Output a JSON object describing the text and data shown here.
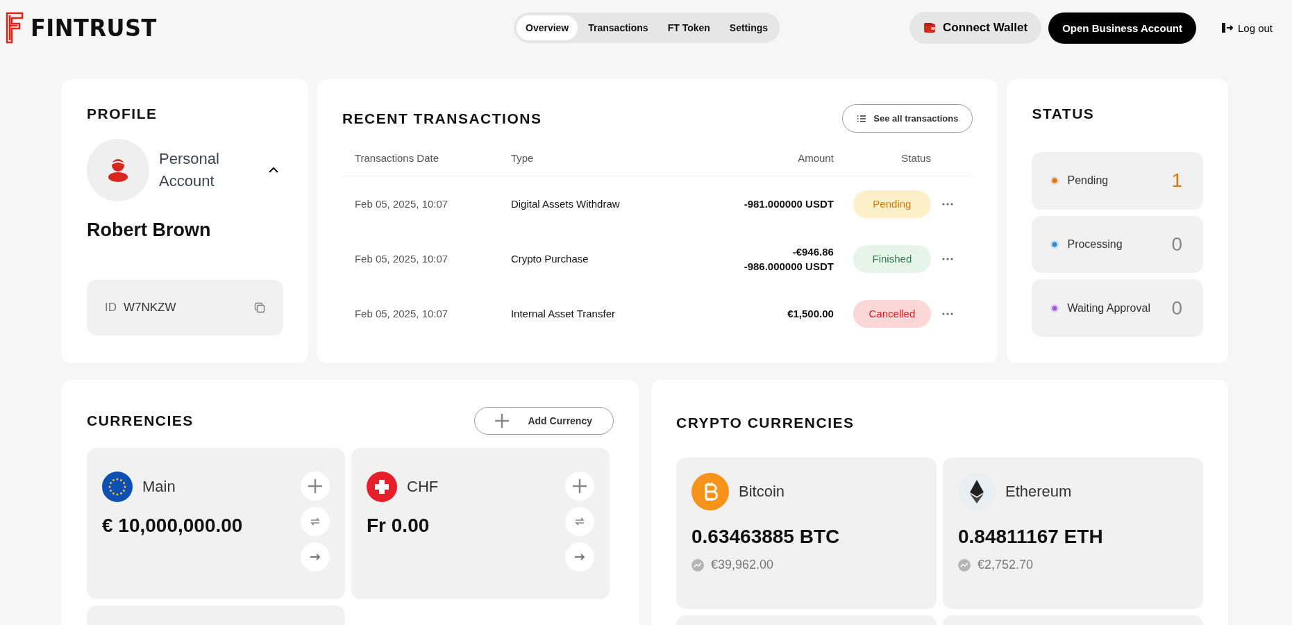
{
  "header": {
    "logo": "FINTRUST",
    "tabs": [
      {
        "label": "Overview",
        "selected": true
      },
      {
        "label": "Transactions",
        "selected": false
      },
      {
        "label": "FT Token",
        "selected": false
      },
      {
        "label": "Settings",
        "selected": false
      }
    ],
    "connect_wallet": "Connect Wallet",
    "open_business": "Open Business Account",
    "logout": "Log out"
  },
  "profile": {
    "title": "PROFILE",
    "account_type": "Personal Account",
    "expanded": true,
    "name": "Robert Brown",
    "id_label": "ID",
    "id_value": "W7NKZW"
  },
  "transactions": {
    "title": "RECENT TRANSACTIONS",
    "see_all": "See all transactions",
    "columns": [
      "Transactions Date",
      "Type",
      "Amount",
      "Status"
    ],
    "rows": [
      {
        "date": "Feb 05, 2025, 10:07",
        "type": "Digital Assets Withdraw",
        "amount": [
          "-981.000000 USDT"
        ],
        "status": "Pending",
        "kind": "pending"
      },
      {
        "date": "Feb 05, 2025, 10:07",
        "type": "Crypto Purchase",
        "amount": [
          "-€946.86",
          "-986.000000 USDT"
        ],
        "status": "Finished",
        "kind": "finished"
      },
      {
        "date": "Feb 05, 2025, 10:07",
        "type": "Internal Asset Transfer",
        "amount": [
          "€1,500.00"
        ],
        "status": "Cancelled",
        "kind": "cancelled"
      }
    ]
  },
  "status": {
    "title": "STATUS",
    "items": [
      {
        "label": "Pending",
        "count": "1",
        "color": "#d97a0a",
        "highlighted": true
      },
      {
        "label": "Processing",
        "count": "0",
        "color": "#2d8fd8",
        "highlighted": false
      },
      {
        "label": "Waiting Approval",
        "count": "0",
        "color": "#a45ae8",
        "highlighted": false
      }
    ]
  },
  "currencies": {
    "title": "CURRENCIES",
    "add": "Add Currency",
    "cards": [
      {
        "kind": "eur",
        "name": "Main",
        "balance": "€ 10,000,000.00"
      },
      {
        "kind": "chf",
        "name": "CHF",
        "balance": "Fr 0.00"
      }
    ]
  },
  "crypto": {
    "title": "CRYPTO CURRENCIES",
    "cards": [
      {
        "kind": "btc",
        "name": "Bitcoin",
        "balance": "0.63463885 BTC",
        "value": "€39,962.00"
      },
      {
        "kind": "eth",
        "name": "Ethereum",
        "balance": "0.84811167 ETH",
        "value": "€2,752.70"
      }
    ]
  }
}
